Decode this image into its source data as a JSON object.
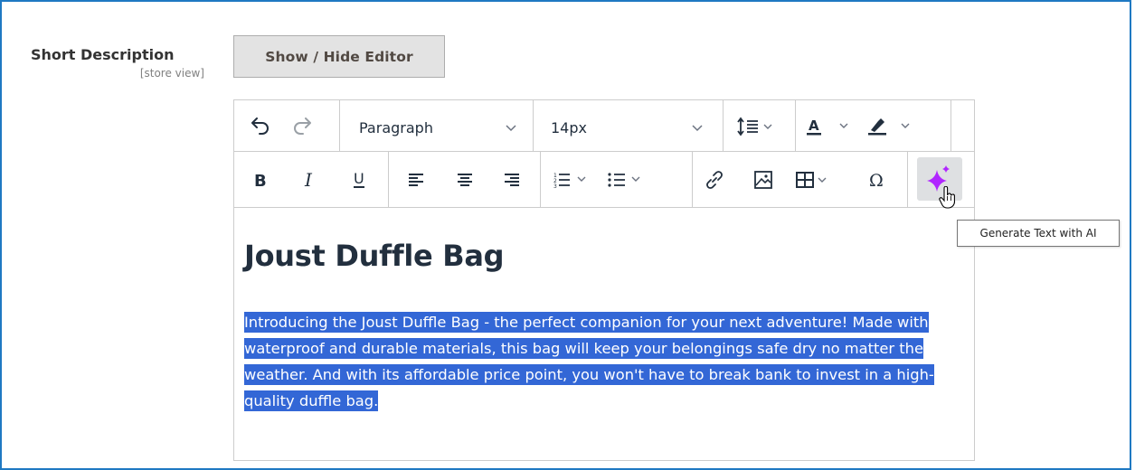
{
  "field": {
    "label": "Short Description",
    "scope": "[store view]"
  },
  "toggle_editor_label": "Show / Hide Editor",
  "toolbar": {
    "block_format": "Paragraph",
    "font_size": "14px",
    "icons": {
      "undo": "undo-icon",
      "redo": "redo-icon",
      "line_height": "line-height-icon",
      "text_color": "text-color-icon",
      "highlight": "highlight-color-icon",
      "bold": "bold-icon",
      "italic": "italic-icon",
      "underline": "underline-icon",
      "align_left": "align-left-icon",
      "align_center": "align-center-icon",
      "align_right": "align-right-icon",
      "numbered_list": "numbered-list-icon",
      "bullet_list": "bullet-list-icon",
      "link": "link-icon",
      "image": "image-icon",
      "table": "table-icon",
      "special_char": "special-character-icon",
      "ai": "sparkle-icon"
    },
    "ai_tooltip": "Generate Text with AI"
  },
  "content": {
    "title": "Joust Duffle Bag",
    "paragraph": "Introducing the Joust Duffle Bag - the perfect companion for your next adventure! Made with waterproof and durable materials, this bag will keep your belongings safe dry no matter the weather. And with its affordable price point, you won't have to break bank to invest in a high-quality duffle bag."
  },
  "colors": {
    "frame_border": "#1f79c2",
    "selection": "#3367d6",
    "ai_sparkle": "#b026ff"
  }
}
